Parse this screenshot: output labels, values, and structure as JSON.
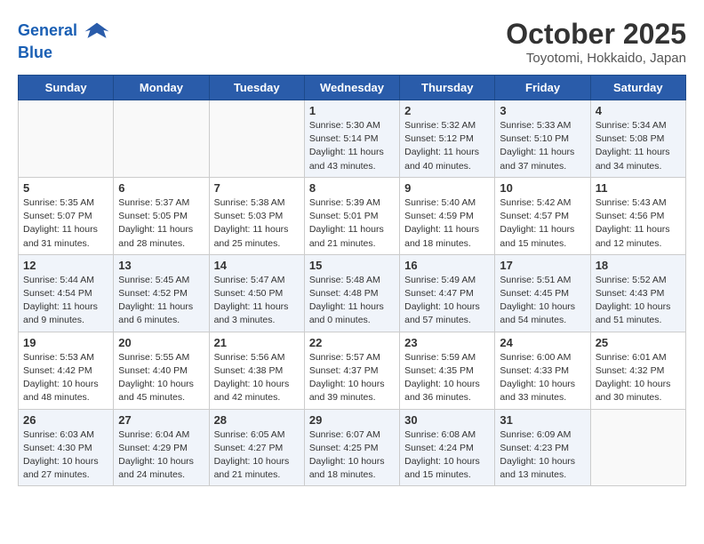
{
  "header": {
    "logo_line1": "General",
    "logo_line2": "Blue",
    "month": "October 2025",
    "location": "Toyotomi, Hokkaido, Japan"
  },
  "weekdays": [
    "Sunday",
    "Monday",
    "Tuesday",
    "Wednesday",
    "Thursday",
    "Friday",
    "Saturday"
  ],
  "weeks": [
    [
      {
        "day": "",
        "info": ""
      },
      {
        "day": "",
        "info": ""
      },
      {
        "day": "",
        "info": ""
      },
      {
        "day": "1",
        "info": "Sunrise: 5:30 AM\nSunset: 5:14 PM\nDaylight: 11 hours\nand 43 minutes."
      },
      {
        "day": "2",
        "info": "Sunrise: 5:32 AM\nSunset: 5:12 PM\nDaylight: 11 hours\nand 40 minutes."
      },
      {
        "day": "3",
        "info": "Sunrise: 5:33 AM\nSunset: 5:10 PM\nDaylight: 11 hours\nand 37 minutes."
      },
      {
        "day": "4",
        "info": "Sunrise: 5:34 AM\nSunset: 5:08 PM\nDaylight: 11 hours\nand 34 minutes."
      }
    ],
    [
      {
        "day": "5",
        "info": "Sunrise: 5:35 AM\nSunset: 5:07 PM\nDaylight: 11 hours\nand 31 minutes."
      },
      {
        "day": "6",
        "info": "Sunrise: 5:37 AM\nSunset: 5:05 PM\nDaylight: 11 hours\nand 28 minutes."
      },
      {
        "day": "7",
        "info": "Sunrise: 5:38 AM\nSunset: 5:03 PM\nDaylight: 11 hours\nand 25 minutes."
      },
      {
        "day": "8",
        "info": "Sunrise: 5:39 AM\nSunset: 5:01 PM\nDaylight: 11 hours\nand 21 minutes."
      },
      {
        "day": "9",
        "info": "Sunrise: 5:40 AM\nSunset: 4:59 PM\nDaylight: 11 hours\nand 18 minutes."
      },
      {
        "day": "10",
        "info": "Sunrise: 5:42 AM\nSunset: 4:57 PM\nDaylight: 11 hours\nand 15 minutes."
      },
      {
        "day": "11",
        "info": "Sunrise: 5:43 AM\nSunset: 4:56 PM\nDaylight: 11 hours\nand 12 minutes."
      }
    ],
    [
      {
        "day": "12",
        "info": "Sunrise: 5:44 AM\nSunset: 4:54 PM\nDaylight: 11 hours\nand 9 minutes."
      },
      {
        "day": "13",
        "info": "Sunrise: 5:45 AM\nSunset: 4:52 PM\nDaylight: 11 hours\nand 6 minutes."
      },
      {
        "day": "14",
        "info": "Sunrise: 5:47 AM\nSunset: 4:50 PM\nDaylight: 11 hours\nand 3 minutes."
      },
      {
        "day": "15",
        "info": "Sunrise: 5:48 AM\nSunset: 4:48 PM\nDaylight: 11 hours\nand 0 minutes."
      },
      {
        "day": "16",
        "info": "Sunrise: 5:49 AM\nSunset: 4:47 PM\nDaylight: 10 hours\nand 57 minutes."
      },
      {
        "day": "17",
        "info": "Sunrise: 5:51 AM\nSunset: 4:45 PM\nDaylight: 10 hours\nand 54 minutes."
      },
      {
        "day": "18",
        "info": "Sunrise: 5:52 AM\nSunset: 4:43 PM\nDaylight: 10 hours\nand 51 minutes."
      }
    ],
    [
      {
        "day": "19",
        "info": "Sunrise: 5:53 AM\nSunset: 4:42 PM\nDaylight: 10 hours\nand 48 minutes."
      },
      {
        "day": "20",
        "info": "Sunrise: 5:55 AM\nSunset: 4:40 PM\nDaylight: 10 hours\nand 45 minutes."
      },
      {
        "day": "21",
        "info": "Sunrise: 5:56 AM\nSunset: 4:38 PM\nDaylight: 10 hours\nand 42 minutes."
      },
      {
        "day": "22",
        "info": "Sunrise: 5:57 AM\nSunset: 4:37 PM\nDaylight: 10 hours\nand 39 minutes."
      },
      {
        "day": "23",
        "info": "Sunrise: 5:59 AM\nSunset: 4:35 PM\nDaylight: 10 hours\nand 36 minutes."
      },
      {
        "day": "24",
        "info": "Sunrise: 6:00 AM\nSunset: 4:33 PM\nDaylight: 10 hours\nand 33 minutes."
      },
      {
        "day": "25",
        "info": "Sunrise: 6:01 AM\nSunset: 4:32 PM\nDaylight: 10 hours\nand 30 minutes."
      }
    ],
    [
      {
        "day": "26",
        "info": "Sunrise: 6:03 AM\nSunset: 4:30 PM\nDaylight: 10 hours\nand 27 minutes."
      },
      {
        "day": "27",
        "info": "Sunrise: 6:04 AM\nSunset: 4:29 PM\nDaylight: 10 hours\nand 24 minutes."
      },
      {
        "day": "28",
        "info": "Sunrise: 6:05 AM\nSunset: 4:27 PM\nDaylight: 10 hours\nand 21 minutes."
      },
      {
        "day": "29",
        "info": "Sunrise: 6:07 AM\nSunset: 4:25 PM\nDaylight: 10 hours\nand 18 minutes."
      },
      {
        "day": "30",
        "info": "Sunrise: 6:08 AM\nSunset: 4:24 PM\nDaylight: 10 hours\nand 15 minutes."
      },
      {
        "day": "31",
        "info": "Sunrise: 6:09 AM\nSunset: 4:23 PM\nDaylight: 10 hours\nand 13 minutes."
      },
      {
        "day": "",
        "info": ""
      }
    ]
  ]
}
